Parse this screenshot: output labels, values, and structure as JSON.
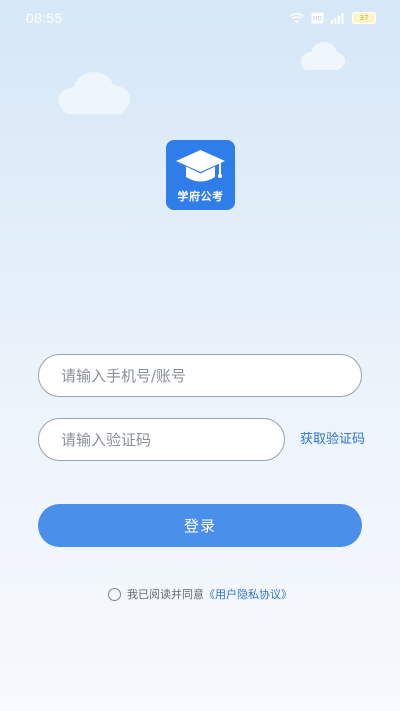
{
  "status_bar": {
    "time": "08:55",
    "icons": [
      "wifi-icon",
      "hd-icon",
      "signal-icon",
      "battery-icon"
    ],
    "hd_label": "HD",
    "battery_label": "37"
  },
  "logo": {
    "app_name": "学府公考",
    "icon": "graduation-cap-icon",
    "bg_color": "#2f7de8"
  },
  "form": {
    "account_placeholder": "请输入手机号/账号",
    "code_placeholder": "请输入验证码",
    "get_code_label": "获取验证码",
    "login_label": "登录"
  },
  "agreement": {
    "text": "我已阅读并同意",
    "link_text": "《用户隐私协议》",
    "checked": false
  },
  "colors": {
    "accent": "#4a90ea",
    "link": "#2f74c9"
  }
}
